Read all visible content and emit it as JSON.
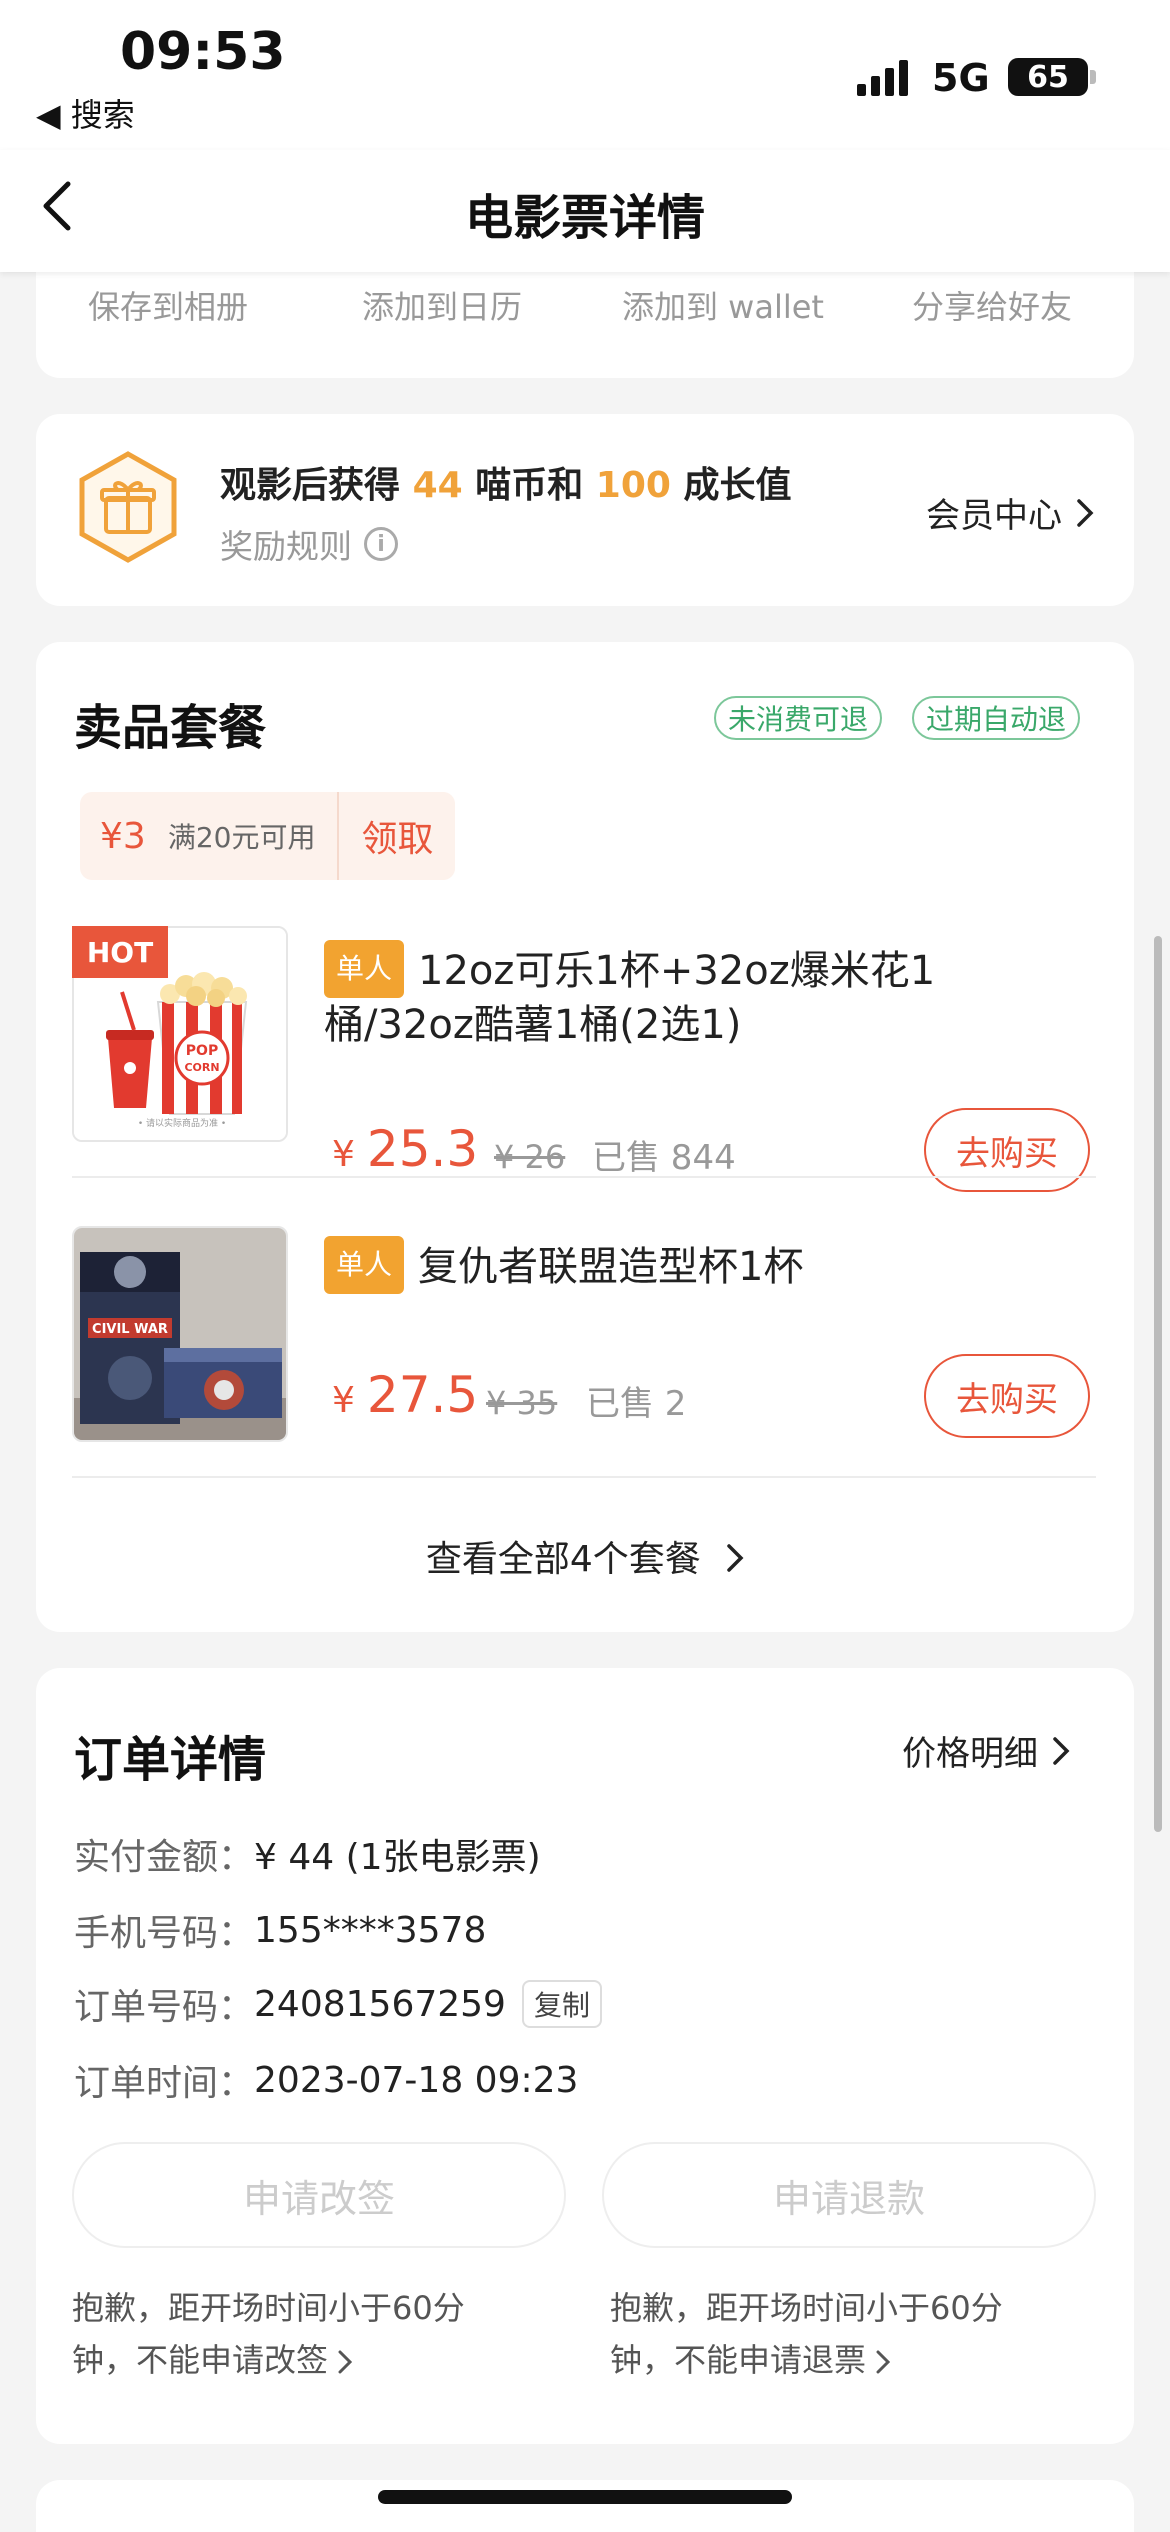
{
  "status_bar": {
    "time": "09:53",
    "back_app": "◀ 搜索",
    "network": "5G",
    "battery": "65"
  },
  "nav": {
    "title": "电影票详情"
  },
  "actions": [
    "保存到相册",
    "添加到日历",
    "添加到 wallet",
    "分享给好友"
  ],
  "reward": {
    "prefix": "观影后获得",
    "coins": "44",
    "coin_label": "喵币和",
    "growth": "100",
    "growth_label": "成长值",
    "rules": "奖励规则",
    "member_center": "会员中心"
  },
  "snacks": {
    "title": "卖品套餐",
    "tags": [
      "未消费可退",
      "过期自动退"
    ],
    "coupon": {
      "amount": "¥3",
      "condition": "满20元可用",
      "claim": "领取"
    },
    "items": [
      {
        "hot": "HOT",
        "badge": "单人",
        "name": "12oz可乐1杯+32oz爆米花1桶/32oz酷薯1桶(2选1)",
        "yen": "¥",
        "price": "25.3",
        "old_price": "¥ 26",
        "sold": "已售 844",
        "buy": "去购买",
        "thumb_note": "• 请以实际商品为准 •"
      },
      {
        "badge": "单人",
        "name": "复仇者联盟造型杯1杯",
        "yen": "¥",
        "price": "27.5",
        "old_price": "¥ 35",
        "sold": "已售 2",
        "buy": "去购买",
        "thumb_text": "CIVIL WAR"
      }
    ],
    "view_all": "查看全部4个套餐"
  },
  "order": {
    "title": "订单详情",
    "price_detail": "价格明细",
    "rows": [
      {
        "k": "实付金额：",
        "v": "¥ 44 (1张电影票)"
      },
      {
        "k": "手机号码：",
        "v": "155****3578"
      },
      {
        "k": "订单号码：",
        "v": "24081567259"
      },
      {
        "k": "订单时间：",
        "v": "2023-07-18 09:23"
      }
    ],
    "copy": "复制",
    "reschedule": "申请改签",
    "refund": "申请退款",
    "reschedule_note": "抱歉，距开场时间小于60分钟，不能申请改签",
    "refund_note": "抱歉，距开场时间小于60分钟，不能申请退票"
  },
  "colors": {
    "accent": "#e8563b",
    "highlight": "#f0a23a",
    "tag_green": "#3aa86a",
    "badge_orange": "#f2a330"
  }
}
